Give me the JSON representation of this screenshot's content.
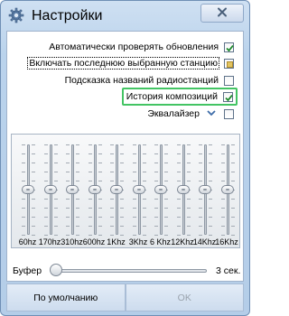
{
  "window": {
    "title": "Настройки"
  },
  "options": [
    {
      "label": "Автоматически проверять обновления",
      "checked": true
    },
    {
      "label": "Включать последнюю выбранную станцию",
      "checked": "partial"
    },
    {
      "label": "Подсказка названий радиостанций",
      "checked": false
    },
    {
      "label": "История композиций",
      "checked": true
    },
    {
      "label": "Эквалайзер",
      "checked": false
    }
  ],
  "equalizer": {
    "bands": [
      {
        "label": "60hz",
        "level": 0.5
      },
      {
        "label": "170hz",
        "level": 0.5
      },
      {
        "label": "310hz",
        "level": 0.5
      },
      {
        "label": "600hz",
        "level": 0.5
      },
      {
        "label": "1Khz",
        "level": 0.5
      },
      {
        "label": "3Khz",
        "level": 0.5
      },
      {
        "label": "6 Khz",
        "level": 0.5
      },
      {
        "label": "12Khz",
        "level": 0.5
      },
      {
        "label": "14Khz",
        "level": 0.5
      },
      {
        "label": "16Khz",
        "level": 0.5
      }
    ]
  },
  "buffer": {
    "label": "Буфер",
    "value_text": "3 сек.",
    "level": 0.0
  },
  "footer": {
    "default_label": "По умолчанию",
    "ok_label": "OK"
  },
  "colors": {
    "highlight_border": "#43c463",
    "check_mark": "#1f8a2e"
  }
}
